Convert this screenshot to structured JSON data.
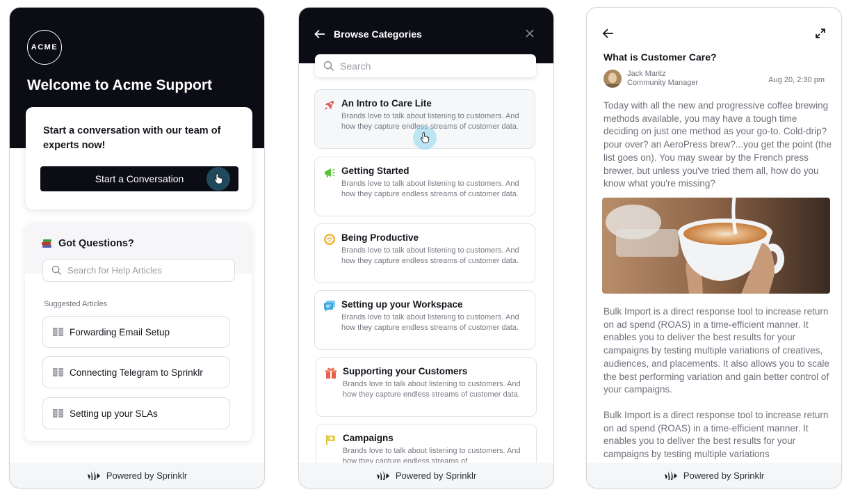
{
  "footer": {
    "label": "Powered by Sprinklr"
  },
  "welcome_panel": {
    "logo_text": "ACME",
    "title": "Welcome to Acme Support",
    "start_card": {
      "prompt": "Start a conversation with our team of experts now!",
      "button_label": "Start a Conversation"
    },
    "questions": {
      "title": "Got Questions?",
      "search_placeholder": "Search for Help Articles",
      "suggested_label": "Suggested Articles",
      "articles": [
        {
          "label": "Forwarding Email Setup",
          "icon": "article-icon"
        },
        {
          "label": "Connecting Telegram to Sprinklr",
          "icon": "article-icon"
        },
        {
          "label": "Setting up your SLAs",
          "icon": "article-icon"
        }
      ]
    }
  },
  "categories_panel": {
    "title": "Browse Categories",
    "search_placeholder": "Search",
    "categories": [
      {
        "title": "An Intro to Care Lite",
        "description": "Brands love to talk about listening to customers. And how they capture endless streams of customer data.",
        "icon": "rocket-icon",
        "color": "#e05a5a"
      },
      {
        "title": "Getting Started",
        "description": "Brands love to talk about listening to customers. And how they capture endless streams of customer data.",
        "icon": "megaphone-icon",
        "color": "#5bbf3a"
      },
      {
        "title": "Being Productive",
        "description": "Brands love to talk about listening to customers. And how they capture endless streams of customer data.",
        "icon": "team-icon",
        "color": "#f2b231"
      },
      {
        "title": "Setting up your Workspace",
        "description": "Brands love to talk about listening to customers. And how they capture endless streams of customer data.",
        "icon": "chat-icon",
        "color": "#3aa7e0"
      },
      {
        "title": "Supporting your Customers",
        "description": "Brands love to talk about listening to customers. And how they capture endless streams of customer data.",
        "icon": "gift-icon",
        "color": "#e8604a"
      },
      {
        "title": "Campaigns",
        "description": "Brands love to talk about listening to customers. And how they capture endless streams of",
        "icon": "flag-icon",
        "color": "#d9c23a"
      }
    ]
  },
  "article_panel": {
    "title": "What is Customer Care?",
    "author_name": "Jack Maritz",
    "author_role": "Community Manager",
    "date": "Aug 20, 2:30 pm",
    "paragraph1": "Today with all the new and progressive coffee brewing methods available, you may have a tough time deciding on just one method as your go-to. Cold-drip? pour over? an AeroPress brew?...you get the point (the list goes on). You may swear by the French press brewer, but unless you've tried them all, how do you know what you're missing?",
    "paragraph2": "Bulk Import is a direct response tool to increase return on ad spend (ROAS) in a time-efficient manner. It enables you to deliver the best results for your campaigns by testing multiple variations of creatives, audiences, and placements. It also allows you to scale the best performing variation and gain better control of your campaigns.",
    "paragraph3": "Bulk Import is a direct response tool to increase return on ad spend (ROAS) in a time-efficient manner. It enables you to deliver the best results for your campaigns by testing multiple variations",
    "image_alt": "latte art coffee cup"
  }
}
